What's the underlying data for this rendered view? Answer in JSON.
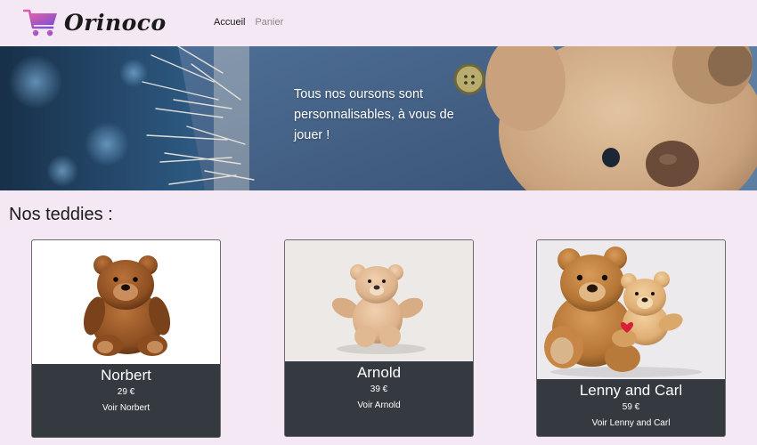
{
  "brand": {
    "name": "Orinoco",
    "icon": "shopping-cart-icon"
  },
  "nav": {
    "items": [
      {
        "label": "Accueil",
        "active": true
      },
      {
        "label": "Panier",
        "active": false
      }
    ]
  },
  "hero": {
    "text": "Tous nos oursons sont personnalisables, à vous de jouer !"
  },
  "section": {
    "title": "Nos teddies :"
  },
  "products": [
    {
      "name": "Norbert",
      "price": "29 €",
      "link": "Voir Norbert"
    },
    {
      "name": "Arnold",
      "price": "39 €",
      "link": "Voir Arnold"
    },
    {
      "name": "Lenny and Carl",
      "price": "59 €",
      "link": "Voir Lenny and Carl"
    }
  ],
  "colors": {
    "background": "#f3e8f3",
    "card_body": "#343a40",
    "brand_gradient_start": "#e25fa8",
    "brand_gradient_end": "#7a4fd6"
  }
}
